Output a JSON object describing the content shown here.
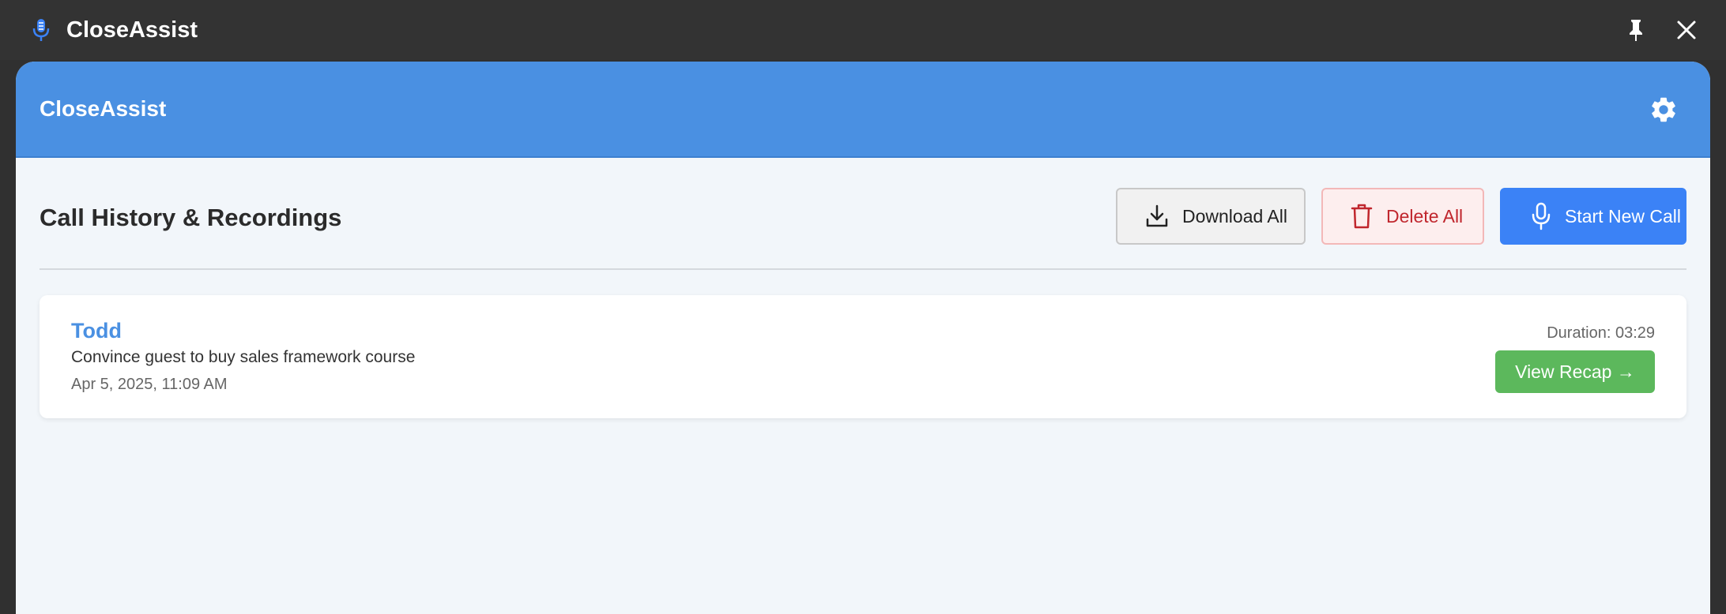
{
  "titlebar": {
    "title": "CloseAssist",
    "app_icon": "microphone-icon",
    "pin_icon": "pin-icon",
    "close_icon": "close-icon"
  },
  "header": {
    "brand": "CloseAssist",
    "settings_icon": "gear-icon",
    "color": "#4a90e2"
  },
  "toolbar": {
    "heading": "Call History & Recordings",
    "download_label": "Download All",
    "delete_label": "Delete All",
    "start_label": "Start New Call"
  },
  "calls": [
    {
      "name": "Todd",
      "description": "Convince guest to buy sales framework course",
      "date": "Apr 5, 2025, 11:09 AM",
      "duration": "Duration: 03:29",
      "recap_label": "View Recap →"
    }
  ],
  "colors": {
    "accent": "#4a90e2",
    "primary_button": "#3b82f6",
    "danger": "#c0262d",
    "success": "#5cb85c"
  }
}
